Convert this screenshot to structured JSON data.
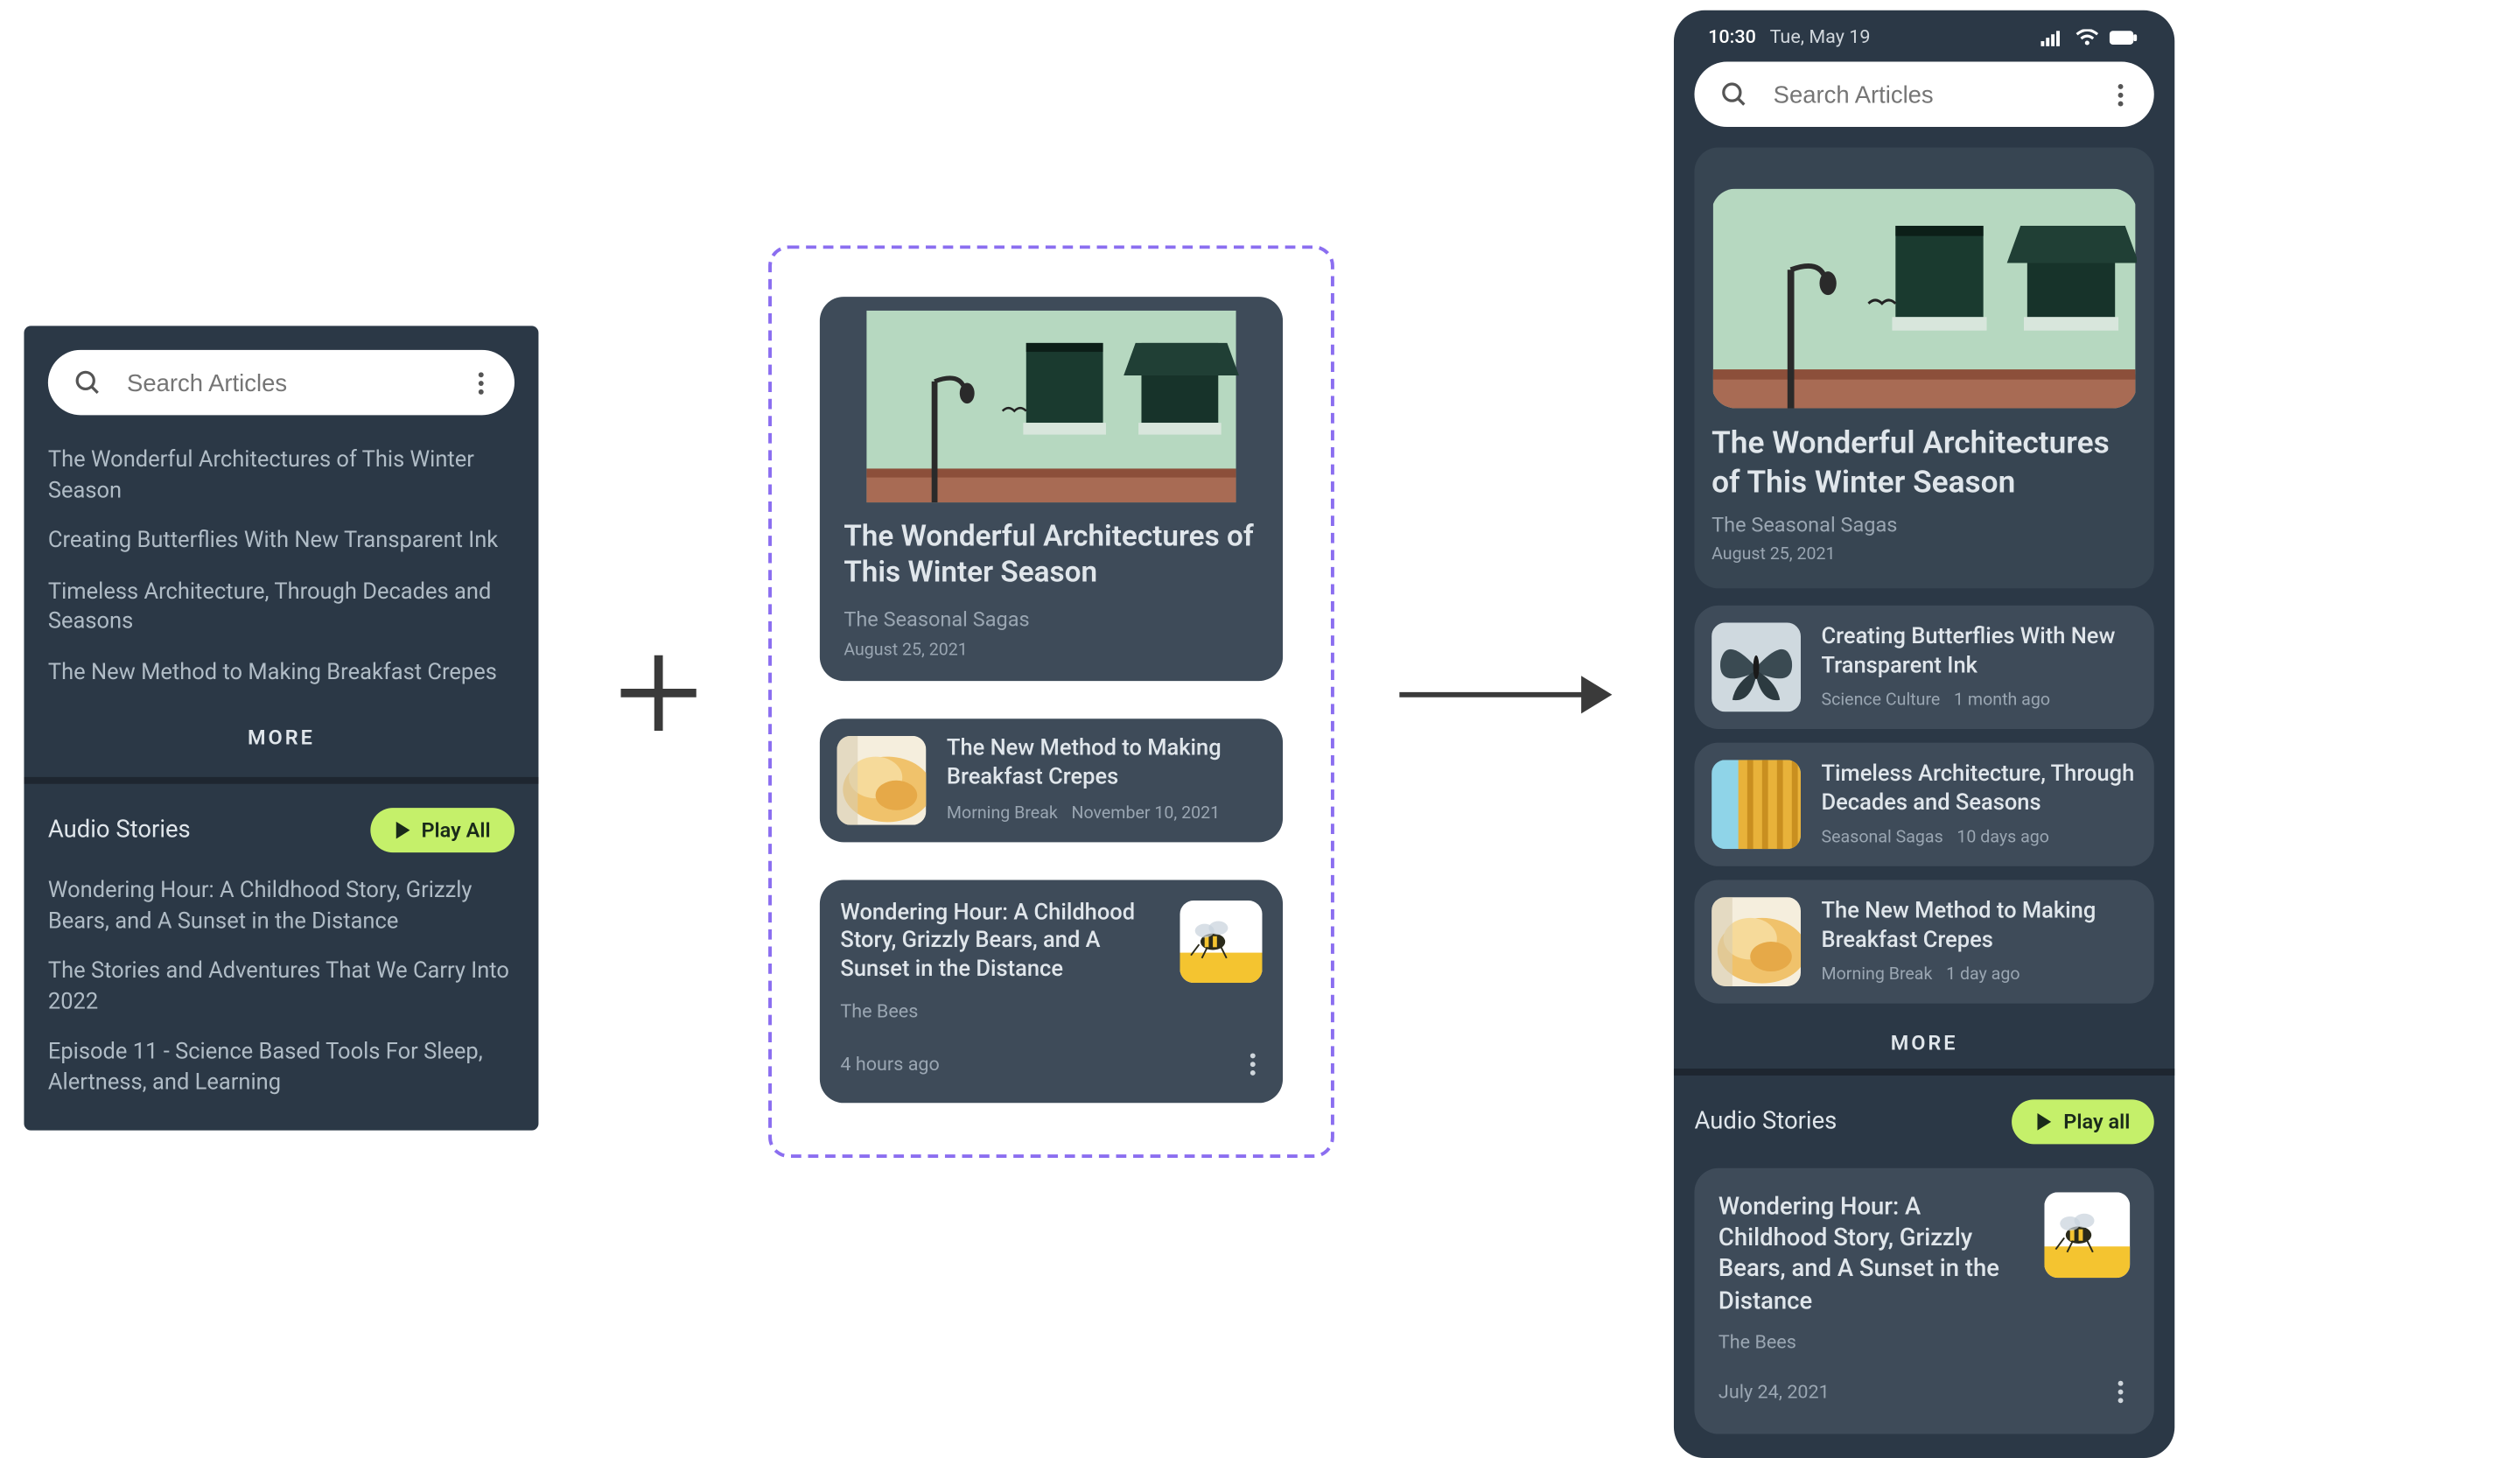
{
  "search": {
    "placeholder": "Search Articles"
  },
  "panel_a": {
    "links": [
      "The Wonderful Architectures of This Winter Season",
      "Creating Butterflies With New Transparent Ink",
      "Timeless Architecture, Through Decades and Seasons",
      "The New Method to Making Breakfast Crepes"
    ],
    "more_label": "MORE",
    "audio_title": "Audio Stories",
    "play_label": "Play All",
    "audio_links": [
      "Wondering Hour: A Childhood Story, Grizzly Bears, and A Sunset in the Distance",
      "The Stories and Adventures That We Carry Into 2022",
      "Episode 11 - Science Based Tools For Sleep, Alertness, and Learning"
    ]
  },
  "panel_b": {
    "hero": {
      "title": "The Wonderful Architectures of This Winter Season",
      "source": "The Seasonal Sagas",
      "date": "August 25, 2021"
    },
    "row_card": {
      "title": "The New Method to Making Breakfast Crepes",
      "source": "Morning Break",
      "date": "November 10, 2021"
    },
    "wide_card": {
      "title": "Wondering Hour: A Childhood Story, Grizzly Bears, and A Sunset in the Distance",
      "source": "The Bees",
      "time": "4 hours ago"
    }
  },
  "panel_c": {
    "status_time": "10:30",
    "status_date": "Tue, May 19",
    "hero": {
      "title": "The Wonderful Architectures of This Winter Season",
      "source": "The Seasonal Sagas",
      "date": "August 25, 2021"
    },
    "list": [
      {
        "title": "Creating Butterflies With New Transparent Ink",
        "source": "Science Culture",
        "time": "1 month ago"
      },
      {
        "title": "Timeless Architecture, Through Decades and Seasons",
        "source": "Seasonal Sagas",
        "time": "10 days ago"
      },
      {
        "title": "The New Method to Making Breakfast Crepes",
        "source": "Morning Break",
        "time": "1 day ago"
      }
    ],
    "more_label": "MORE",
    "audio_title": "Audio Stories",
    "play_label": "Play all",
    "audio_card": {
      "title": "Wondering Hour: A Childhood Story, Grizzly Bears, and A Sunset in the Distance",
      "source": "The Bees",
      "date": "July 24, 2021"
    }
  }
}
